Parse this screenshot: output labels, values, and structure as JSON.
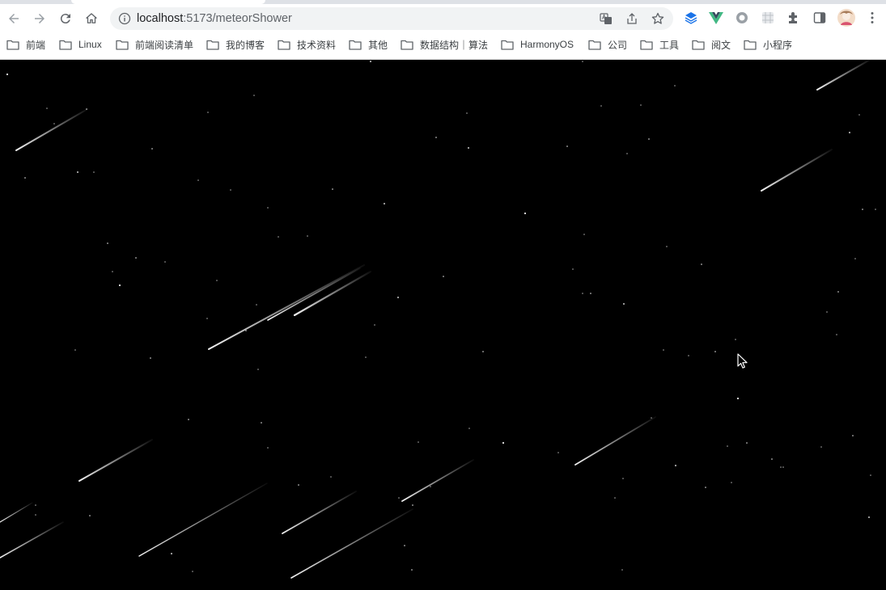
{
  "browser": {
    "url_host": "localhost",
    "url_path": ":5173/meteorShower",
    "nav": {
      "back": "back-icon",
      "forward": "forward-icon",
      "reload": "reload-icon",
      "home": "home-icon"
    },
    "bookmarks": [
      {
        "label": "前端"
      },
      {
        "label": "Linux"
      },
      {
        "label": "前端阅读清单"
      },
      {
        "label": "我的博客"
      },
      {
        "label": "技术资料"
      },
      {
        "label": "其他"
      },
      {
        "label": "数据结构｜算法"
      },
      {
        "label": "HarmonyOS"
      },
      {
        "label": "公司"
      },
      {
        "label": "工具"
      },
      {
        "label": "阅文"
      },
      {
        "label": "小程序"
      }
    ]
  },
  "scene": {
    "background": "#000000",
    "meteor_color": "#ffffff",
    "star_color": "#ffffff"
  }
}
